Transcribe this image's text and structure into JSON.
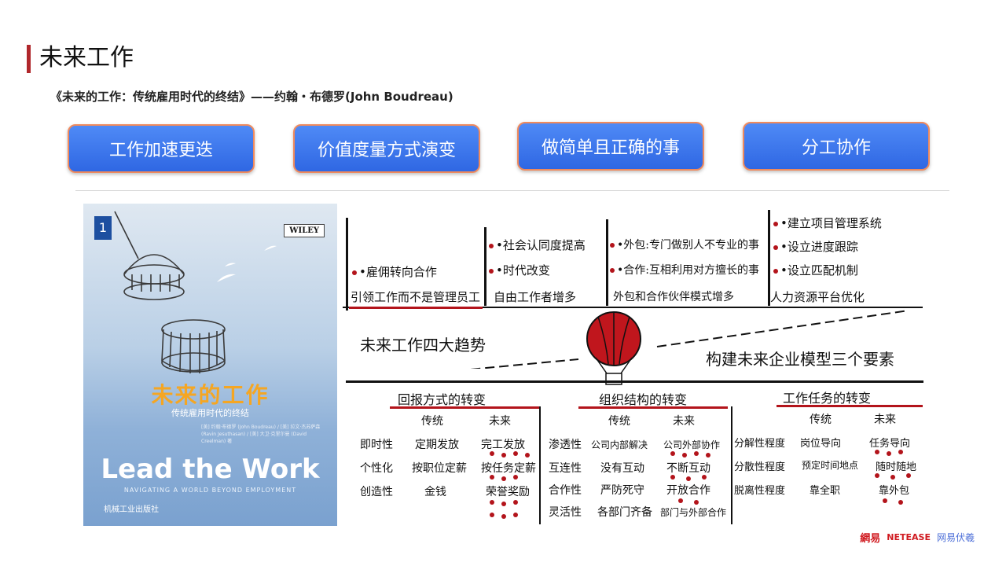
{
  "header": {
    "title": "未来工作",
    "subtitle": "《未来的工作：传统雇用时代的终结》——约翰・布德罗(John Boudreau)"
  },
  "pills": [
    "工作加速更迭",
    "价值度量方式演变",
    "做简单且正确的事",
    "分工协作"
  ],
  "book": {
    "publisher_logo": "WILEY",
    "cn_title": "未来的工作",
    "cn_subtitle": "传统雇用时代的终结",
    "en_title": "Lead the Work",
    "en_subtitle": "NAVIGATING A WORLD BEYOND EMPLOYMENT",
    "press": "机械工业出版社",
    "authors": "[美] 约翰·布德罗 (John Boudreau) / [美] 拉文·杰苏萨森 (Ravin Jesuthasan) / [美] 大卫·克里尔曼 (David Creelman) 著"
  },
  "sketch": {
    "top_columns": [
      {
        "lines": [
          "•雇佣转向合作",
          "引领工作而不是管理员工"
        ]
      },
      {
        "lines": [
          "•社会认同度提高",
          "•时代改变",
          "自由工作者增多"
        ]
      },
      {
        "lines": [
          "•外包:专门做别人不专业的事",
          "•合作:互相利用对方擅长的事",
          "外包和合作伙伴模式增多"
        ]
      },
      {
        "lines": [
          "•建立项目管理系统",
          "•设立进度跟踪",
          "•设立匹配机制",
          "人力资源平台优化"
        ]
      }
    ],
    "left_heading": "未来工作四大趋势",
    "right_heading": "构建未来企业模型三个要素",
    "sections": [
      {
        "title": "回报方式的转变",
        "header": [
          "传统",
          "未来"
        ],
        "rows": [
          [
            "即时性",
            "定期发放",
            "完工发放"
          ],
          [
            "个性化",
            "按职位定薪",
            "按任务定薪"
          ],
          [
            "创造性",
            "金钱",
            "荣誉奖励"
          ]
        ]
      },
      {
        "title": "组织结构的转变",
        "header": [
          "传统",
          "未来"
        ],
        "rows": [
          [
            "渗透性",
            "公司内部解决",
            "公司外部协作"
          ],
          [
            "互连性",
            "没有互动",
            "不断互动"
          ],
          [
            "合作性",
            "严防死守",
            "开放合作"
          ],
          [
            "灵活性",
            "各部门齐备",
            "部门与外部合作"
          ]
        ]
      },
      {
        "title": "工作任务的转变",
        "header": [
          "传统",
          "未来"
        ],
        "rows": [
          [
            "分解性程度",
            "岗位导向",
            "任务导向"
          ],
          [
            "分散性程度",
            "预定时间地点",
            "随时随地"
          ],
          [
            "脱离性程度",
            "靠全职",
            "靠外包"
          ]
        ]
      }
    ]
  },
  "footer": {
    "brand_cn": "網易",
    "brand_en": "NETEASE",
    "partner": "网易伏羲"
  },
  "colors": {
    "accent": "#b0272b",
    "pill": "#3b74ea",
    "pill_border": "#f08a5d",
    "sketch_red": "#b3141b"
  }
}
